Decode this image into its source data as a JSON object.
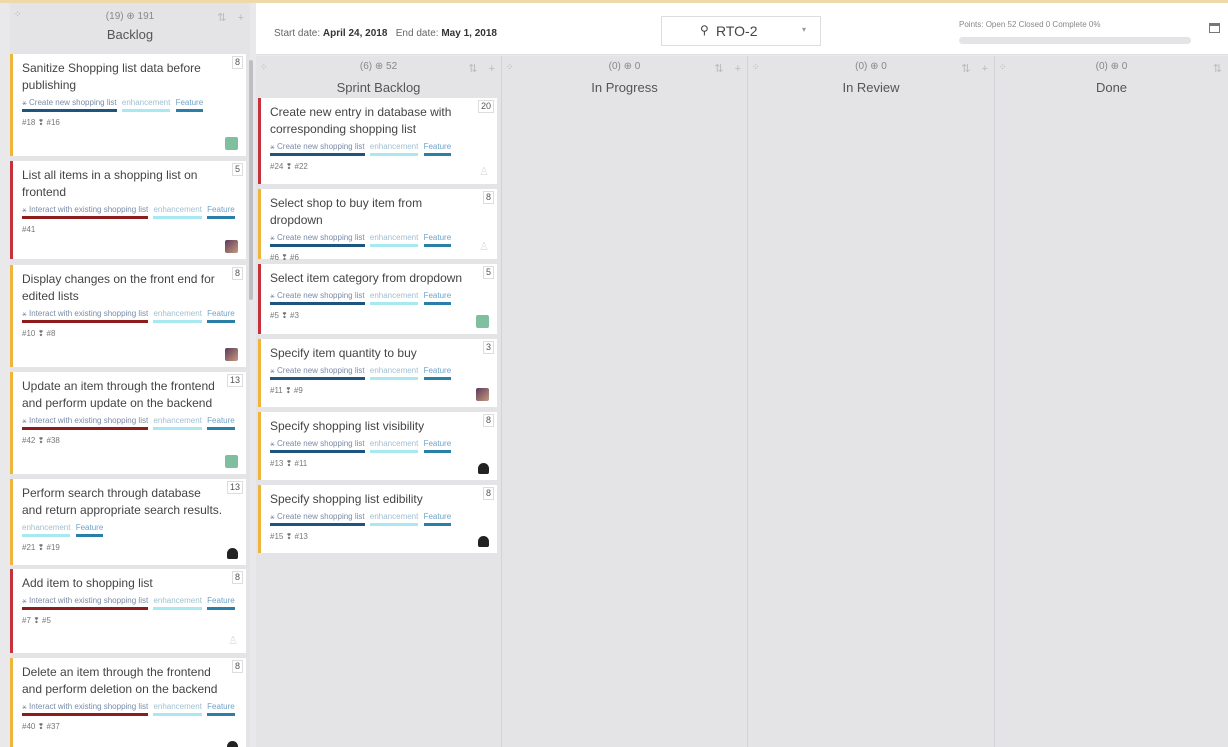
{
  "backlog": {
    "counts": "(19) ⊕ 191",
    "title": "Backlog",
    "cards": [
      {
        "title": "Sanitize Shopping list data before publishing",
        "points": "8",
        "epic": "⚹ Create new shopping list",
        "tags": [
          "enhancement",
          "Feature"
        ],
        "meta": "#18 ❢ #16",
        "avatar": "robot"
      },
      {
        "title": "List all items in a shopping list on frontend",
        "points": "5",
        "epic": "⚹ Interact with existing shopping list",
        "tags": [
          "enhancement",
          "Feature"
        ],
        "meta": "#41",
        "avatar": "photo"
      },
      {
        "title": "Display changes on the front end for edited lists",
        "points": "8",
        "epic": "⚹ Interact with existing shopping list",
        "tags": [
          "enhancement",
          "Feature"
        ],
        "meta": "#10 ❢ #8",
        "avatar": "photo"
      },
      {
        "title": "Update an item through the frontend and perform update on the backend",
        "points": "13",
        "epic": "⚹ Interact with existing shopping list",
        "tags": [
          "enhancement",
          "Feature"
        ],
        "meta": "#42 ❢ #38",
        "avatar": "robot"
      },
      {
        "title": "Perform search through database and return appropriate search results.",
        "points": "13",
        "epic": "",
        "tags": [
          "enhancement",
          "Feature"
        ],
        "meta": "#21 ❢ #19",
        "avatar": "octo"
      },
      {
        "title": "Add item to shopping list",
        "points": "8",
        "epic": "⚹ Interact with existing shopping list",
        "tags": [
          "enhancement",
          "Feature"
        ],
        "meta": "#7 ❢ #5",
        "avatar": "ghost"
      },
      {
        "title": "Delete an item through the frontend and perform deletion on the backend",
        "points": "8",
        "epic": "⚹ Interact with existing shopping list",
        "tags": [
          "enhancement",
          "Feature"
        ],
        "meta": "#40 ❢ #37",
        "avatar": "octo"
      }
    ]
  },
  "topbar": {
    "start_label": "Start date:",
    "start_value": "April 24, 2018",
    "end_label": "End date:",
    "end_value": "May 1, 2018",
    "sprint_icon": "⚲",
    "sprint": "RTO-2",
    "sprint_caret": "▾",
    "points_label": "Points:",
    "points_text": "Open 52 Closed 0 Complete 0%",
    "progress": 0
  },
  "columns": [
    {
      "counts": "(6) ⊕ 52",
      "title": "Sprint Backlog"
    },
    {
      "counts": "(0) ⊕ 0",
      "title": "In Progress"
    },
    {
      "counts": "(0) ⊕ 0",
      "title": "In Review"
    },
    {
      "counts": "(0) ⊕ 0",
      "title": "Done"
    }
  ],
  "sprint_cards": [
    {
      "title": "Create new entry in database with corresponding shopping list",
      "points": "20",
      "epic": "⚹ Create new shopping list",
      "tags": [
        "enhancement",
        "Feature"
      ],
      "meta": "#24 ❢ #22",
      "avatar": "ghost"
    },
    {
      "title": "Select shop to buy item from dropdown",
      "points": "8",
      "epic": "⚹ Create new shopping list",
      "tags": [
        "enhancement",
        "Feature"
      ],
      "meta": "#6 ❢ #6",
      "avatar": "ghost"
    },
    {
      "title": "Select item category from dropdown",
      "points": "5",
      "epic": "⚹ Create new shopping list",
      "tags": [
        "enhancement",
        "Feature"
      ],
      "meta": "#5 ❢ #3",
      "avatar": "robot"
    },
    {
      "title": "Specify item quantity to buy",
      "points": "3",
      "epic": "⚹ Create new shopping list",
      "tags": [
        "enhancement",
        "Feature"
      ],
      "meta": "#11 ❢ #9",
      "avatar": "photo"
    },
    {
      "title": "Specify shopping list visibility",
      "points": "8",
      "epic": "⚹ Create new shopping list",
      "tags": [
        "enhancement",
        "Feature"
      ],
      "meta": "#13 ❢ #11",
      "avatar": "octo"
    },
    {
      "title": "Specify shopping list edibility",
      "points": "8",
      "epic": "⚹ Create new shopping list",
      "tags": [
        "enhancement",
        "Feature"
      ],
      "meta": "#15 ❢ #13",
      "avatar": "octo"
    }
  ],
  "icons": {
    "drag_handle": "⁘",
    "sort": "⇅",
    "add": "+",
    "ghost_avatar": "♙"
  }
}
